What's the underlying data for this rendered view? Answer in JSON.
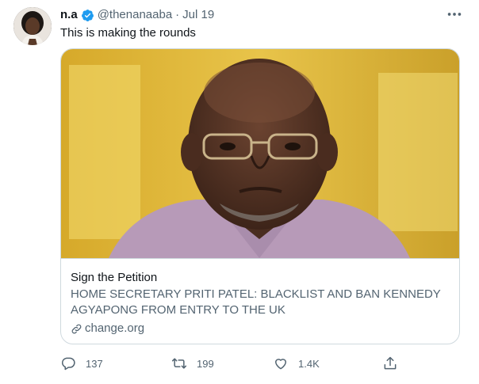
{
  "author": {
    "name": "n.a",
    "handle": "@thenanaaba",
    "separator": "·",
    "date": "Jul 19"
  },
  "tweet": {
    "text": "This is making the rounds"
  },
  "card": {
    "title": "Sign the Petition",
    "description": "HOME SECRETARY PRITI PATEL: BLACKLIST AND BAN KENNEDY AGYAPONG FROM ENTRY TO THE UK",
    "domain": "change.org"
  },
  "actions": {
    "reply_count": "137",
    "retweet_count": "199",
    "like_count": "1.4K"
  },
  "icons": {
    "verified": "verified-badge-icon",
    "more": "more-options-icon",
    "link": "link-icon",
    "reply": "reply-icon",
    "retweet": "retweet-icon",
    "like": "like-icon",
    "share": "share-icon"
  },
  "colors": {
    "accent": "#1d9bf0",
    "secondary_text": "#536471",
    "border": "#cfd9de"
  }
}
